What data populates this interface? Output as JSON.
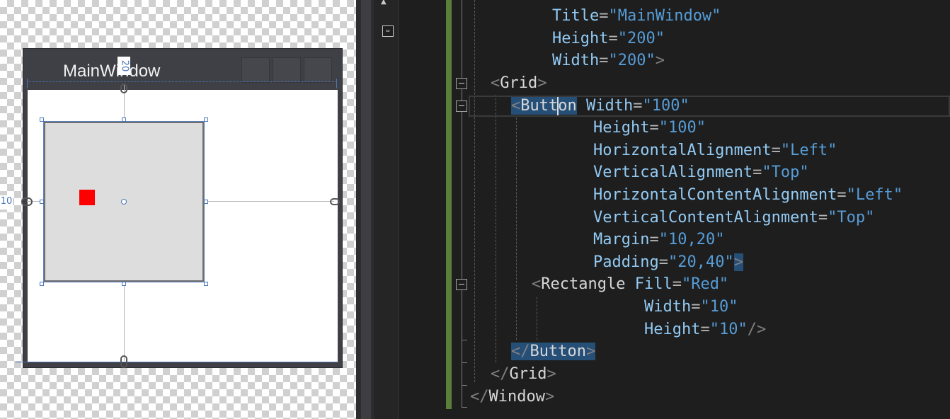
{
  "designer": {
    "window_title": "MainWindow",
    "margin_top_label": "20",
    "margin_left_label": "10",
    "button_fill": "#dddddd",
    "rectangle_fill": "#ff0000"
  },
  "editor": {
    "lines": {
      "title_attr": "Title",
      "title_val": "\"MainWindow\"",
      "height_attr": "Height",
      "height_val": "\"200\"",
      "width_attr": "Width",
      "width_val": "\"200\"",
      "grid_tag": "Grid",
      "button_tag_a": "Butt",
      "button_tag_b": "on",
      "btn_width_attr": "Width",
      "btn_width_val": "\"100\"",
      "btn_height_attr": "Height",
      "btn_height_val": "\"100\"",
      "ha_attr": "HorizontalAlignment",
      "ha_val": "\"Left\"",
      "va_attr": "VerticalAlignment",
      "va_val": "\"Top\"",
      "hca_attr": "HorizontalContentAlignment",
      "hca_val": "\"Left\"",
      "vca_attr": "VerticalContentAlignment",
      "vca_val": "\"Top\"",
      "margin_attr": "Margin",
      "margin_val": "\"10,20\"",
      "padding_attr": "Padding",
      "padding_val": "\"20,40\"",
      "rect_tag": "Rectangle",
      "fill_attr": "Fill",
      "fill_val": "\"Red\"",
      "rwidth_attr": "Width",
      "rwidth_val": "\"10\"",
      "rheight_attr": "Height",
      "rheight_val": "\"10\"",
      "button_close_tag": "Button",
      "grid_close_tag": "Grid",
      "window_close_tag": "Window"
    },
    "colors": {
      "attribute": "#92caf4",
      "value": "#569cd6",
      "change_bar": "#5a7f3b",
      "selection": "#264f78"
    }
  }
}
